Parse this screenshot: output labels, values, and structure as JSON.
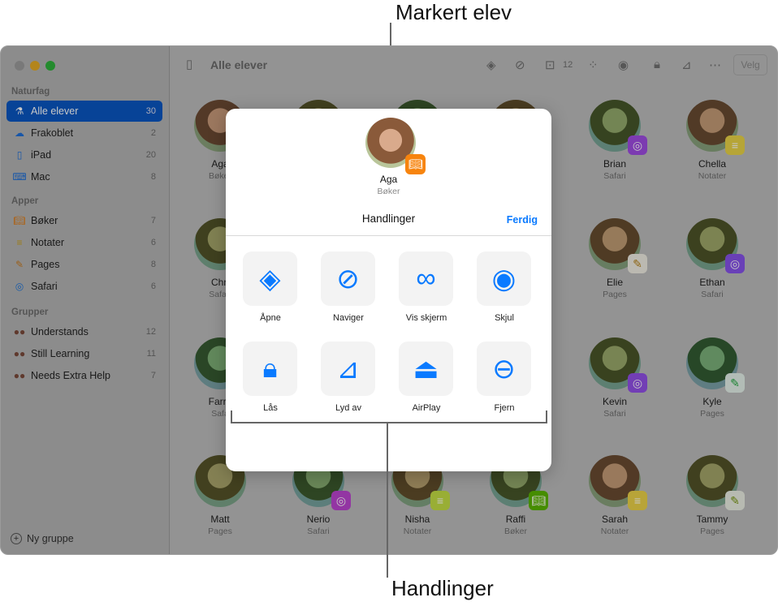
{
  "callouts": {
    "top": "Markert elev",
    "bottom": "Handlinger"
  },
  "sidebar": {
    "sections": [
      {
        "title": "Naturfag",
        "items": [
          {
            "label": "Alle elever",
            "count": "30",
            "icon": "microscope-icon"
          },
          {
            "label": "Frakoblet",
            "count": "2",
            "icon": "cloud-slash-icon"
          },
          {
            "label": "iPad",
            "count": "20",
            "icon": "ipad-icon"
          },
          {
            "label": "Mac",
            "count": "8",
            "icon": "laptop-icon"
          }
        ]
      },
      {
        "title": "Apper",
        "items": [
          {
            "label": "Bøker",
            "count": "7",
            "icon": "books-app-icon"
          },
          {
            "label": "Notater",
            "count": "6",
            "icon": "notes-app-icon"
          },
          {
            "label": "Pages",
            "count": "8",
            "icon": "pages-app-icon"
          },
          {
            "label": "Safari",
            "count": "6",
            "icon": "safari-app-icon"
          }
        ]
      },
      {
        "title": "Grupper",
        "items": [
          {
            "label": "Understands",
            "count": "12",
            "icon": "group-avatars-icon"
          },
          {
            "label": "Still Learning",
            "count": "11",
            "icon": "group-avatars-icon"
          },
          {
            "label": "Needs Extra Help",
            "count": "7",
            "icon": "group-avatars-icon"
          }
        ]
      }
    ],
    "new_group": "Ny gruppe"
  },
  "toolbar": {
    "title": "Alle elever",
    "inbox_count": "12",
    "select": "Velg"
  },
  "students": [
    {
      "name": "Aga",
      "app": "Bøker"
    },
    {},
    {},
    {},
    {
      "name": "Brian",
      "app": "Safari"
    },
    {
      "name": "Chella",
      "app": "Notater"
    },
    {
      "name": "Chri",
      "app": "Safari"
    },
    {},
    {},
    {},
    {
      "name": "Elie",
      "app": "Pages"
    },
    {
      "name": "Ethan",
      "app": "Safari"
    },
    {
      "name": "Farra",
      "app": "Safa"
    },
    {},
    {},
    {},
    {
      "name": "Kevin",
      "app": "Safari"
    },
    {
      "name": "Kyle",
      "app": "Pages"
    },
    {
      "name": "Matt",
      "app": "Pages"
    },
    {
      "name": "Nerio",
      "app": "Safari"
    },
    {
      "name": "Nisha",
      "app": "Notater"
    },
    {
      "name": "Raffi",
      "app": "Bøker"
    },
    {
      "name": "Sarah",
      "app": "Notater"
    },
    {
      "name": "Tammy",
      "app": "Pages"
    }
  ],
  "popover": {
    "student": "Aga",
    "app": "Bøker",
    "title": "Handlinger",
    "done": "Ferdig",
    "actions": [
      {
        "label": "Åpne",
        "icon": "layers-icon"
      },
      {
        "label": "Naviger",
        "icon": "compass-icon"
      },
      {
        "label": "Vis skjerm",
        "icon": "binoculars-icon"
      },
      {
        "label": "Skjul",
        "icon": "eye-slash-icon"
      },
      {
        "label": "Lås",
        "icon": "lock-icon"
      },
      {
        "label": "Lyd av",
        "icon": "speaker-slash-icon"
      },
      {
        "label": "AirPlay",
        "icon": "airplay-icon"
      },
      {
        "label": "Fjern",
        "icon": "person-remove-icon"
      }
    ]
  },
  "colors": {
    "accent": "#0a7aff",
    "selected": "#0a57c2"
  }
}
